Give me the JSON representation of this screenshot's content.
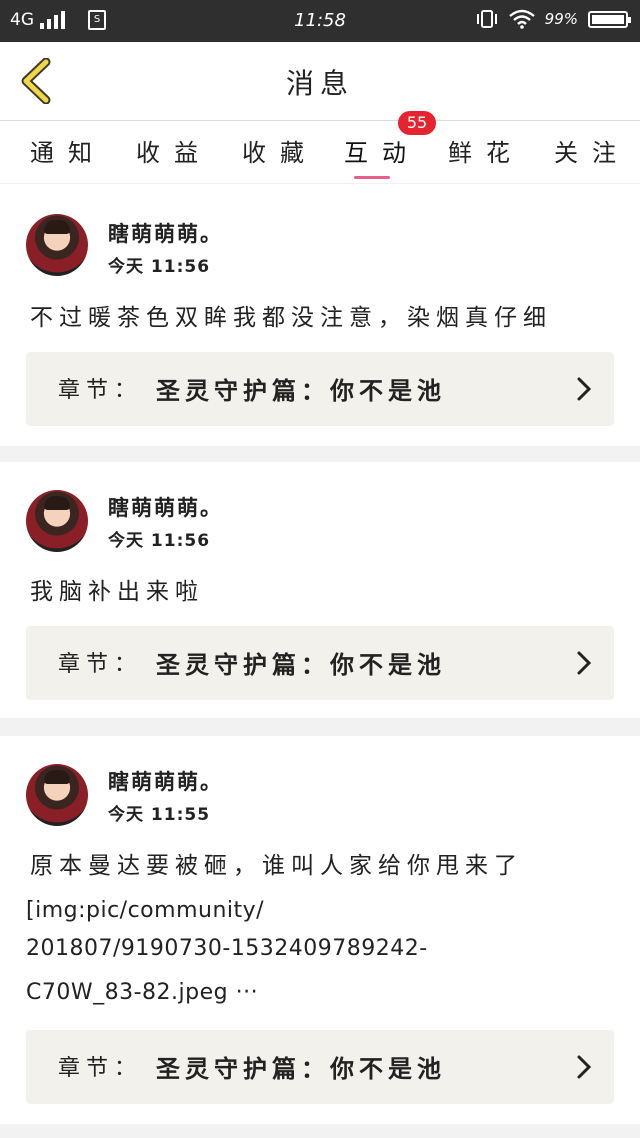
{
  "status_bar": {
    "network": "4G",
    "sim_icon": "S",
    "time": "11:58",
    "battery": "99%",
    "battery_level": 0.99
  },
  "header": {
    "title": "消息",
    "back_icon": "chevron-left-icon"
  },
  "tabs": [
    {
      "label": "通知"
    },
    {
      "label": "收益"
    },
    {
      "label": "收藏"
    },
    {
      "label": "互动",
      "badge": "55",
      "active": true
    },
    {
      "label": "鲜花"
    },
    {
      "label": "关注"
    }
  ],
  "accent_color": "#e8608a",
  "badge_color": "#e6242f",
  "messages": [
    {
      "user": "瞎萌萌萌。",
      "time": "今天 11:56",
      "text": "不过暖茶色双眸我都没注意，染烟真仔细",
      "chapter_label": "章节：",
      "chapter_name": "圣灵守护篇：你不是池"
    },
    {
      "user": "瞎萌萌萌。",
      "time": "今天 11:56",
      "text": "我脑补出来啦",
      "chapter_label": "章节：",
      "chapter_name": "圣灵守护篇：你不是池"
    },
    {
      "user": "瞎萌萌萌。",
      "time": "今天 11:55",
      "text": "原本曼达要被砸，谁叫人家给你甩来了",
      "link_lines": [
        "[img:pic/community/",
        "201807/9190730-1532409789242-",
        "C70W_83-82.jpeg ···"
      ],
      "chapter_label": "章节：",
      "chapter_name": "圣灵守护篇：你不是池"
    }
  ]
}
